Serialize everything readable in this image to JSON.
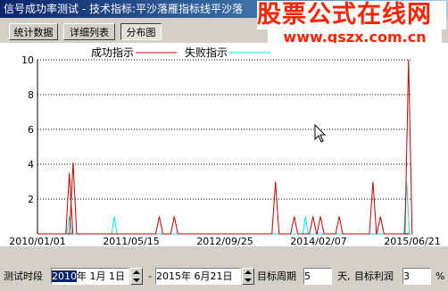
{
  "window": {
    "title": "信号成功率测试 - 技术指标:平沙落雁指标线平沙落"
  },
  "watermark": {
    "text": "股票公式在线网",
    "url": "www.gszx.com.cn"
  },
  "toolbar": {
    "tabs": [
      {
        "label": "统计数据"
      },
      {
        "label": "详细列表"
      },
      {
        "label": "分布图"
      }
    ]
  },
  "chart_data": {
    "type": "line",
    "legend_position": "top",
    "series": [
      {
        "name": "成功指示",
        "color": "#c80000"
      },
      {
        "name": "失败指示",
        "color": "#00e6e6"
      }
    ],
    "ylim": [
      0,
      10
    ],
    "yticks": [
      "2",
      "4",
      "6",
      "8",
      "10"
    ],
    "xticks": [
      "2010/01/01",
      "2011/05/15",
      "2012/09/25",
      "2014/02/07",
      "2015/06/21"
    ],
    "grid": "horizontal dotted",
    "success_values": [
      {
        "x": 0.085,
        "y": 3.5
      },
      {
        "x": 0.095,
        "y": 4.1
      },
      {
        "x": 0.325,
        "y": 1.0
      },
      {
        "x": 0.365,
        "y": 1.0
      },
      {
        "x": 0.635,
        "y": 3.0
      },
      {
        "x": 0.685,
        "y": 1.0
      },
      {
        "x": 0.735,
        "y": 1.0
      },
      {
        "x": 0.755,
        "y": 1.0
      },
      {
        "x": 0.805,
        "y": 1.0
      },
      {
        "x": 0.895,
        "y": 3.0
      },
      {
        "x": 0.915,
        "y": 1.0
      },
      {
        "x": 0.99,
        "y": 10.0
      }
    ],
    "failure_values": [
      {
        "x": 0.085,
        "y": 1.0
      },
      {
        "x": 0.205,
        "y": 1.0
      },
      {
        "x": 0.715,
        "y": 1.0
      },
      {
        "x": 0.985,
        "y": 3.0
      }
    ]
  },
  "bottom": {
    "test_period_label": "测试时段",
    "start_year_sel": "2010",
    "start_rest": "年  1月  1日",
    "separator": "-",
    "end_date": "2015年  6月21日",
    "period_label": "目标周期",
    "period_value": "5",
    "day_label": "天,",
    "profit_label": "目标利润",
    "profit_value": "3",
    "percent": "%"
  }
}
